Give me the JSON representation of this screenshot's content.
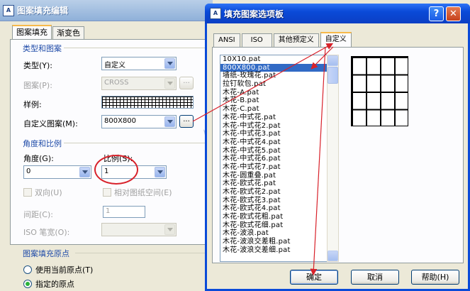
{
  "hatch_dialog": {
    "title": "图案填充编辑",
    "tabs": [
      "图案填充",
      "渐变色"
    ],
    "type_section": {
      "heading": "类型和图案",
      "type_label": "类型(Y):",
      "type_value": "自定义",
      "pattern_label": "图案(P):",
      "pattern_value": "CROSS",
      "swatch_label": "样例:",
      "custom_label": "自定义图案(M):",
      "custom_value": "800X800",
      "browse_label": "..."
    },
    "angle_section": {
      "heading": "角度和比例",
      "angle_label": "角度(G):",
      "angle_value": "0",
      "scale_label": "比例(S):",
      "scale_value": "1",
      "double_label": "双向(U)",
      "relative_label": "相对图纸空间(E)",
      "spacing_label": "间距(C):",
      "spacing_value": "1",
      "iso_label": "ISO 笔宽(O):"
    },
    "origin_section": {
      "heading": "图案填充原点",
      "use_current": "使用当前原点(T)",
      "specified": "指定的原点"
    }
  },
  "palette_dialog": {
    "title": "填充图案选项板",
    "help_label": "?",
    "close_label": "✕",
    "tabs": [
      "ANSI",
      "ISO",
      "其他预定义",
      "自定义"
    ],
    "patterns": [
      "10X10.pat",
      "800X800.pat",
      "墙纸-玫瑰花.pat",
      "拉钉软包.pat",
      "木花-A.pat",
      "木花-B.pat",
      "木花-C.pat",
      "木花-中式花.pat",
      "木花-中式花2.pat",
      "木花-中式花3.pat",
      "木花-中式花4.pat",
      "木花-中式花5.pat",
      "木花-中式花6.pat",
      "木花-中式花7.pat",
      "木花-圆重叠.pat",
      "木花-欧式花.pat",
      "木花-欧式花2.pat",
      "木花-欧式花3.pat",
      "木花-欧式花4.pat",
      "木花-欧式花粗.pat",
      "木花-欧式花细.pat",
      "木花-波浪.pat",
      "木花-波浪交差粗.pat",
      "木花-波浪交差细.pat"
    ],
    "selected_index": 1,
    "ok_label": "确定",
    "cancel_label": "取消",
    "help_button_label": "帮助(H)"
  },
  "colors": {
    "annotation_red": "#d8212a",
    "selection_blue": "#316ac5",
    "xp_title_blue": "#0a4ad8"
  }
}
